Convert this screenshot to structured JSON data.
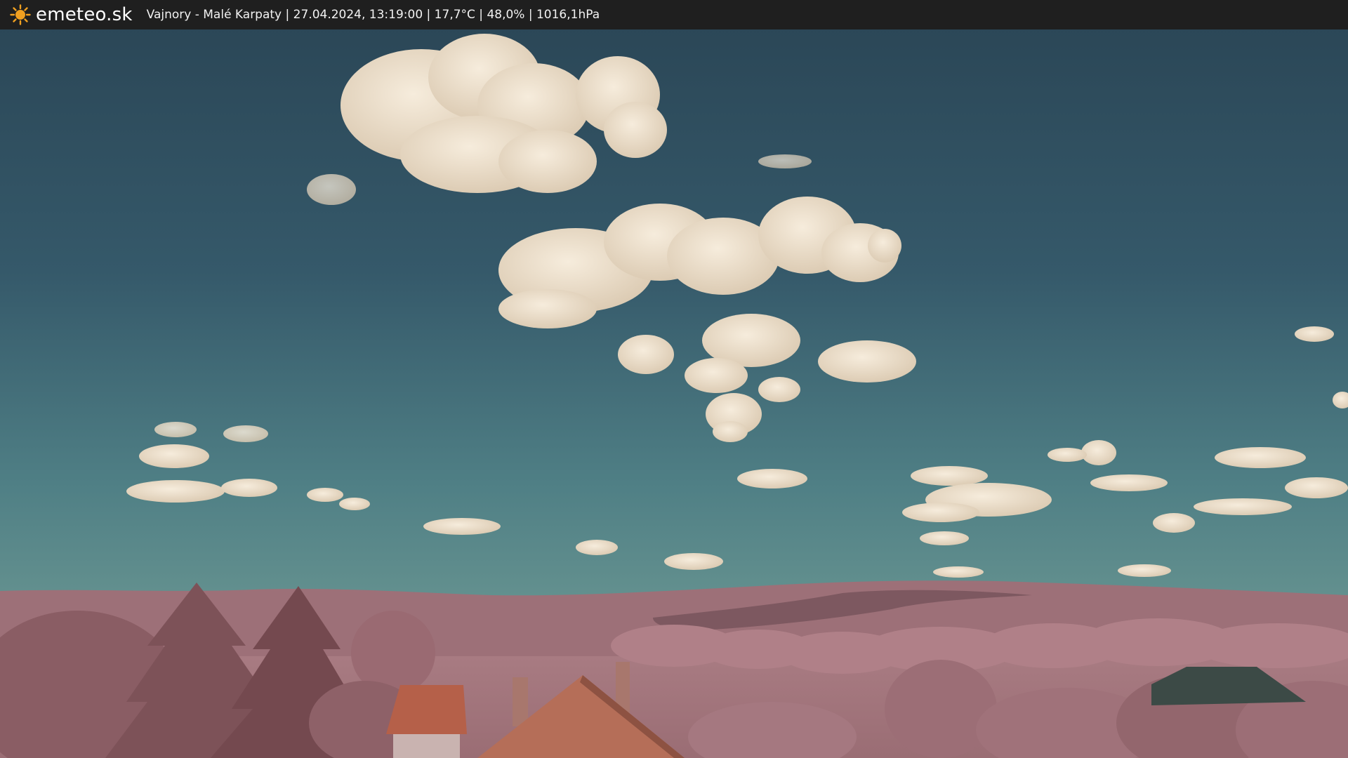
{
  "header": {
    "brand": "emeteo.sk",
    "logo_icon": "sun-icon",
    "caption": "Vajnory - Malé Karpaty | 27.04.2024, 13:19:00 | 17,7°C | 48,0% | 1016,1hPa"
  },
  "colors": {
    "topbar": "#1f1f1f",
    "logo_sun": "#f0a020",
    "sky_top": "#2b4757",
    "sky_horizon": "#5c8c8f",
    "clouds": "#eadbc5",
    "foliage": "#a8737b",
    "roof": "#b96a4e"
  }
}
